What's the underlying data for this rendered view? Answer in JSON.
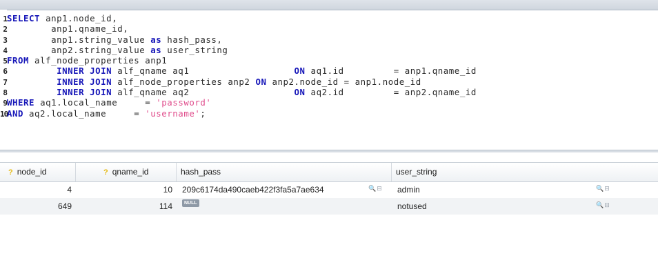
{
  "editor": {
    "lines": [
      {
        "n": "1"
      },
      {
        "n": "2"
      },
      {
        "n": "3"
      },
      {
        "n": "4"
      },
      {
        "n": "5"
      },
      {
        "n": "6"
      },
      {
        "n": "7"
      },
      {
        "n": "8"
      },
      {
        "n": "9"
      },
      {
        "n": "10"
      }
    ],
    "sql": {
      "l1a": "SELECT",
      "l1b": " anp1.node_id,",
      "l2": "        anp1.qname_id,",
      "l3a": "        anp1.string_value ",
      "l3b": "as",
      "l3c": " hash_pass,",
      "l4a": "        anp2.string_value ",
      "l4b": "as",
      "l4c": " user_string",
      "l5a": "FROM",
      "l5b": " alf_node_properties anp1",
      "l6a": "         INNER JOIN",
      "l6b": " alf_qname aq1                   ",
      "l6c": "ON",
      "l6d": " aq1.id         = anp1.qname_id",
      "l7a": "         INNER JOIN",
      "l7b": " alf_node_properties anp2 ",
      "l7c": "ON",
      "l7d": " anp2.node_id = anp1.node_id",
      "l8a": "         INNER JOIN",
      "l8b": " alf_qname aq2                   ",
      "l8c": "ON",
      "l8d": " aq2.id         = anp2.qname_id",
      "l9a": "WHERE",
      "l9b": " aq1.local_name     = ",
      "l9c": "'password'",
      "l10a": "AND",
      "l10b": " aq2.local_name     = ",
      "l10c": "'username'",
      "l10d": ";"
    }
  },
  "grid": {
    "columns": [
      {
        "label": "node_id",
        "key_icon": "?"
      },
      {
        "label": "qname_id",
        "key_icon": "?"
      },
      {
        "label": "hash_pass"
      },
      {
        "label": "user_string"
      }
    ],
    "rows": [
      {
        "node_id": "4",
        "qname_id": "10",
        "hash_pass": "209c6174da490caeb422f3fa5a7ae634",
        "user_string": "admin"
      },
      {
        "node_id": "649",
        "qname_id": "114",
        "hash_pass_null": "NULL",
        "user_string": "notused"
      }
    ],
    "cell_icons": "🔍⊟",
    "colors": {
      "keyword": "#1515b8",
      "string": "#e04d8c",
      "key_icon": "#e5b80b"
    }
  }
}
